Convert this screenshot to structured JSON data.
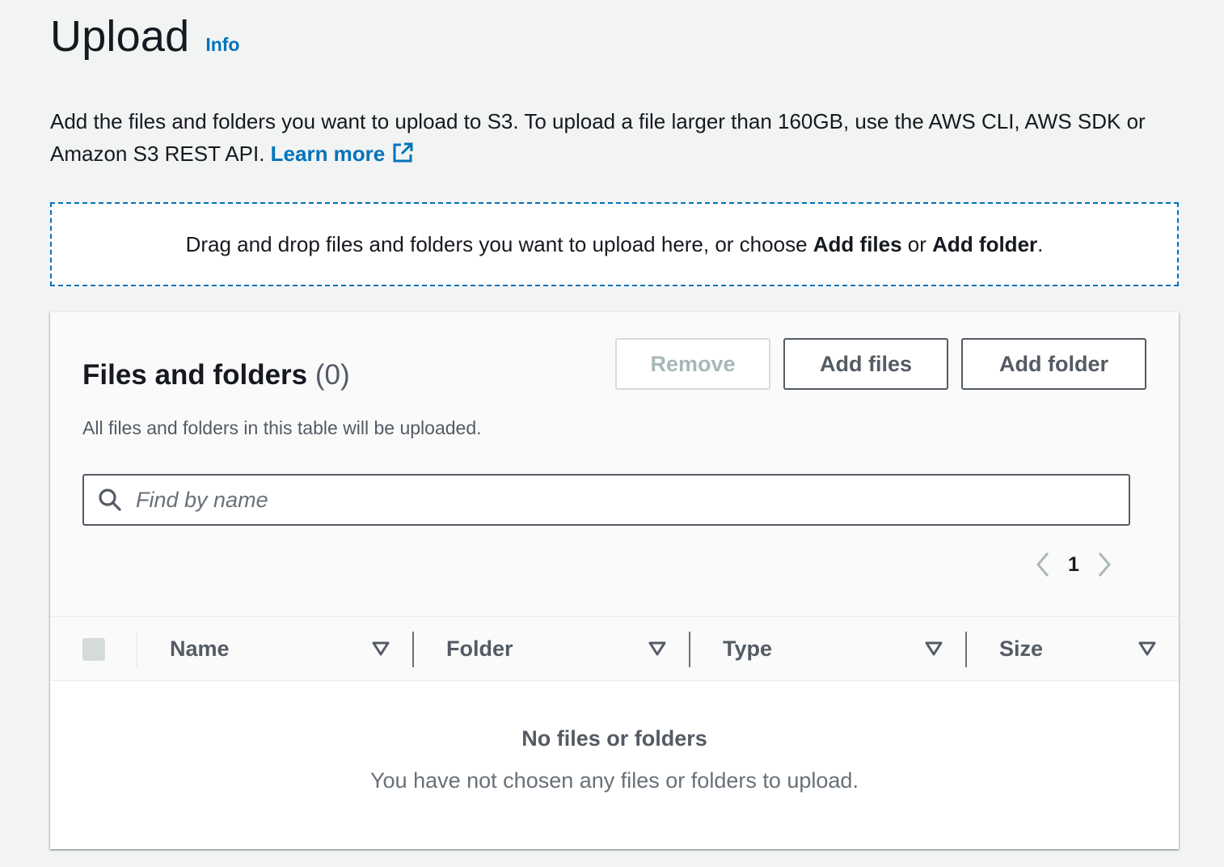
{
  "header": {
    "title": "Upload",
    "info_label": "Info"
  },
  "description": {
    "text": "Add the files and folders you want to upload to S3. To upload a file larger than 160GB, use the AWS CLI, AWS SDK or Amazon S3 REST API.",
    "learn_more": "Learn more",
    "learn_more_icon": "external-link-icon"
  },
  "dropzone": {
    "prefix": "Drag and drop files and folders you want to upload here, or choose",
    "add_files": "Add files",
    "or": "or",
    "add_folder": "Add folder",
    "suffix": "."
  },
  "panel": {
    "title": "Files and folders",
    "count": "(0)",
    "description": "All files and folders in this table will be uploaded.",
    "buttons": {
      "remove": "Remove",
      "add_files": "Add files",
      "add_folder": "Add folder"
    },
    "search": {
      "placeholder": "Find by name",
      "value": "",
      "icon": "search-icon"
    },
    "pagination": {
      "current_page": "1",
      "prev_icon": "chevron-left-icon",
      "next_icon": "chevron-right-icon"
    },
    "table": {
      "columns": [
        {
          "label": "Name",
          "sort_icon": "sort-down-icon"
        },
        {
          "label": "Folder",
          "sort_icon": "sort-down-icon"
        },
        {
          "label": "Type",
          "sort_icon": "sort-down-icon"
        },
        {
          "label": "Size",
          "sort_icon": "sort-down-icon"
        }
      ],
      "rows": [],
      "empty_title": "No files or folders",
      "empty_description": "You have not chosen any files or folders to upload."
    }
  },
  "colors": {
    "link": "#0073bb",
    "text": "#16191f",
    "secondary_text": "#545b64",
    "background": "#f2f3f3"
  }
}
